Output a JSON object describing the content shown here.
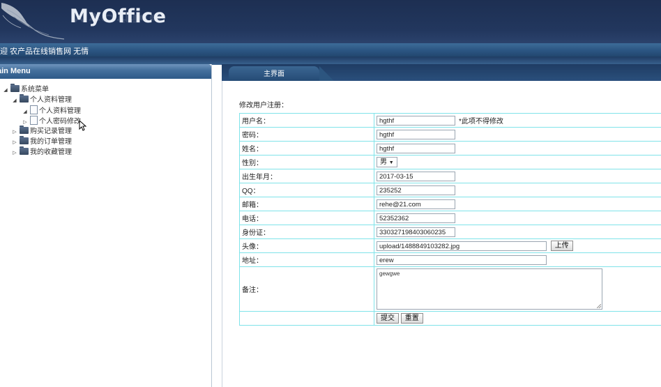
{
  "app": {
    "logo": "MyOffice",
    "welcome": "迎 农产品在线销售网 无情"
  },
  "sidebar": {
    "title": "ain Menu",
    "tree": {
      "root": "系统菜单",
      "profile_group": "个人资料管理",
      "profile_manage": "个人资料管理",
      "password_change": "个人密码修改",
      "purchase_records": "购买记录管理",
      "my_orders": "我的订单管理",
      "my_favorites": "我的收藏管理"
    }
  },
  "tabs": {
    "main": "主界面"
  },
  "form": {
    "title": "修改用户注册：",
    "labels": {
      "username": "用户名：",
      "password": "密码：",
      "name": "姓名：",
      "gender": "性别：",
      "birthdate": "出生年月：",
      "qq": "QQ：",
      "email": "邮箱：",
      "phone": "电话：",
      "idcard": "身份证：",
      "avatar": "头像：",
      "address": "地址：",
      "remarks": "备注："
    },
    "values": {
      "username": "hgthf",
      "password": "hgthf",
      "name": "hgthf",
      "gender": "男",
      "birthdate": "2017-03-15",
      "qq": "235252",
      "email": "rehe@21.com",
      "phone": "52352362",
      "idcard": "330327198403060235",
      "avatar": "upload/1488849103282.jpg",
      "address": "erew",
      "remarks": "gewgwe"
    },
    "username_note": "*此项不得修改",
    "upload_button": "上传",
    "submit_button": "提交",
    "reset_button": "重置"
  }
}
